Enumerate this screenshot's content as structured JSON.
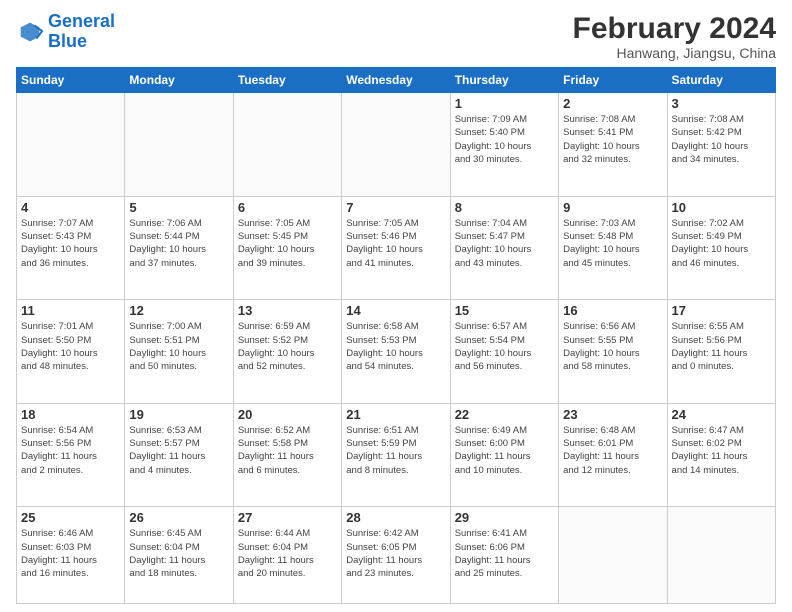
{
  "logo": {
    "line1": "General",
    "line2": "Blue"
  },
  "header": {
    "month": "February 2024",
    "location": "Hanwang, Jiangsu, China"
  },
  "weekdays": [
    "Sunday",
    "Monday",
    "Tuesday",
    "Wednesday",
    "Thursday",
    "Friday",
    "Saturday"
  ],
  "weeks": [
    [
      {
        "day": "",
        "info": ""
      },
      {
        "day": "",
        "info": ""
      },
      {
        "day": "",
        "info": ""
      },
      {
        "day": "",
        "info": ""
      },
      {
        "day": "1",
        "info": "Sunrise: 7:09 AM\nSunset: 5:40 PM\nDaylight: 10 hours\nand 30 minutes."
      },
      {
        "day": "2",
        "info": "Sunrise: 7:08 AM\nSunset: 5:41 PM\nDaylight: 10 hours\nand 32 minutes."
      },
      {
        "day": "3",
        "info": "Sunrise: 7:08 AM\nSunset: 5:42 PM\nDaylight: 10 hours\nand 34 minutes."
      }
    ],
    [
      {
        "day": "4",
        "info": "Sunrise: 7:07 AM\nSunset: 5:43 PM\nDaylight: 10 hours\nand 36 minutes."
      },
      {
        "day": "5",
        "info": "Sunrise: 7:06 AM\nSunset: 5:44 PM\nDaylight: 10 hours\nand 37 minutes."
      },
      {
        "day": "6",
        "info": "Sunrise: 7:05 AM\nSunset: 5:45 PM\nDaylight: 10 hours\nand 39 minutes."
      },
      {
        "day": "7",
        "info": "Sunrise: 7:05 AM\nSunset: 5:46 PM\nDaylight: 10 hours\nand 41 minutes."
      },
      {
        "day": "8",
        "info": "Sunrise: 7:04 AM\nSunset: 5:47 PM\nDaylight: 10 hours\nand 43 minutes."
      },
      {
        "day": "9",
        "info": "Sunrise: 7:03 AM\nSunset: 5:48 PM\nDaylight: 10 hours\nand 45 minutes."
      },
      {
        "day": "10",
        "info": "Sunrise: 7:02 AM\nSunset: 5:49 PM\nDaylight: 10 hours\nand 46 minutes."
      }
    ],
    [
      {
        "day": "11",
        "info": "Sunrise: 7:01 AM\nSunset: 5:50 PM\nDaylight: 10 hours\nand 48 minutes."
      },
      {
        "day": "12",
        "info": "Sunrise: 7:00 AM\nSunset: 5:51 PM\nDaylight: 10 hours\nand 50 minutes."
      },
      {
        "day": "13",
        "info": "Sunrise: 6:59 AM\nSunset: 5:52 PM\nDaylight: 10 hours\nand 52 minutes."
      },
      {
        "day": "14",
        "info": "Sunrise: 6:58 AM\nSunset: 5:53 PM\nDaylight: 10 hours\nand 54 minutes."
      },
      {
        "day": "15",
        "info": "Sunrise: 6:57 AM\nSunset: 5:54 PM\nDaylight: 10 hours\nand 56 minutes."
      },
      {
        "day": "16",
        "info": "Sunrise: 6:56 AM\nSunset: 5:55 PM\nDaylight: 10 hours\nand 58 minutes."
      },
      {
        "day": "17",
        "info": "Sunrise: 6:55 AM\nSunset: 5:56 PM\nDaylight: 11 hours\nand 0 minutes."
      }
    ],
    [
      {
        "day": "18",
        "info": "Sunrise: 6:54 AM\nSunset: 5:56 PM\nDaylight: 11 hours\nand 2 minutes."
      },
      {
        "day": "19",
        "info": "Sunrise: 6:53 AM\nSunset: 5:57 PM\nDaylight: 11 hours\nand 4 minutes."
      },
      {
        "day": "20",
        "info": "Sunrise: 6:52 AM\nSunset: 5:58 PM\nDaylight: 11 hours\nand 6 minutes."
      },
      {
        "day": "21",
        "info": "Sunrise: 6:51 AM\nSunset: 5:59 PM\nDaylight: 11 hours\nand 8 minutes."
      },
      {
        "day": "22",
        "info": "Sunrise: 6:49 AM\nSunset: 6:00 PM\nDaylight: 11 hours\nand 10 minutes."
      },
      {
        "day": "23",
        "info": "Sunrise: 6:48 AM\nSunset: 6:01 PM\nDaylight: 11 hours\nand 12 minutes."
      },
      {
        "day": "24",
        "info": "Sunrise: 6:47 AM\nSunset: 6:02 PM\nDaylight: 11 hours\nand 14 minutes."
      }
    ],
    [
      {
        "day": "25",
        "info": "Sunrise: 6:46 AM\nSunset: 6:03 PM\nDaylight: 11 hours\nand 16 minutes."
      },
      {
        "day": "26",
        "info": "Sunrise: 6:45 AM\nSunset: 6:04 PM\nDaylight: 11 hours\nand 18 minutes."
      },
      {
        "day": "27",
        "info": "Sunrise: 6:44 AM\nSunset: 6:04 PM\nDaylight: 11 hours\nand 20 minutes."
      },
      {
        "day": "28",
        "info": "Sunrise: 6:42 AM\nSunset: 6:05 PM\nDaylight: 11 hours\nand 23 minutes."
      },
      {
        "day": "29",
        "info": "Sunrise: 6:41 AM\nSunset: 6:06 PM\nDaylight: 11 hours\nand 25 minutes."
      },
      {
        "day": "",
        "info": ""
      },
      {
        "day": "",
        "info": ""
      }
    ]
  ]
}
